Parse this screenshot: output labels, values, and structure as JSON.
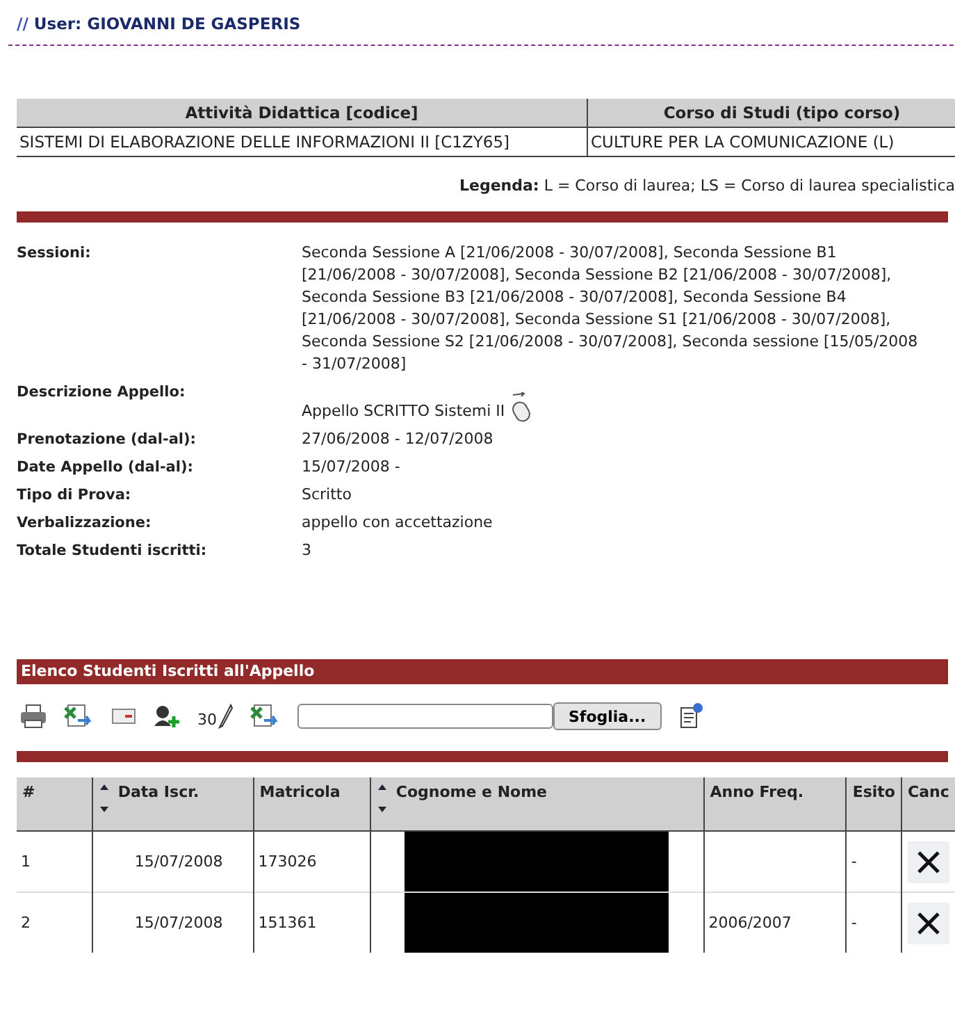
{
  "user_header": {
    "prefix": "//",
    "label": "User: GIOVANNI DE GASPERIS"
  },
  "course_table": {
    "columns": [
      "Attività Didattica [codice]",
      "Corso di Studi (tipo corso)"
    ],
    "rows": [
      [
        "SISTEMI DI ELABORAZIONE DELLE INFORMAZIONI II [C1ZY65]",
        "CULTURE PER LA COMUNICAZIONE (L)"
      ]
    ]
  },
  "legend": "**Legenda:** L = Corso di laurea; LS = Corso di laurea specialistica",
  "details": [
    {
      "label": "Sessioni:",
      "value": "Seconda Sessione A [21/06/2008 - 30/07/2008], Seconda Sessione B1 [21/06/2008 - 30/07/2008], Seconda Sessione B2 [21/06/2008 - 30/07/2008], Seconda Sessione B3 [21/06/2008 - 30/07/2008], Seconda Sessione B4 [21/06/2008 - 30/07/2008], Seconda Sessione S1 [21/06/2008 - 30/07/2008], Seconda Sessione S2 [21/06/2008 - 30/07/2008], Seconda sessione [15/05/2008 - 31/07/2008]",
      "kind": "text"
    },
    {
      "label": "Descrizione Appello:",
      "value": "Appello SCRITTO Sistemi II",
      "kind": "with_icon"
    },
    {
      "label": "Prenotazione (dal-al):",
      "value": "27/06/2008 - 12/07/2008",
      "kind": "text"
    },
    {
      "label": "Date Appello (dal-al):",
      "value": "15/07/2008 -",
      "kind": "text"
    },
    {
      "label": "Tipo di Prova:",
      "value": "Scritto",
      "kind": "text"
    },
    {
      "label": "Verbalizzazione:",
      "value": "appello con accettazione",
      "kind": "text"
    },
    {
      "label": "Totale Studenti iscritti:",
      "value": "3",
      "kind": "text"
    }
  ],
  "students_section": {
    "title": "Elenco Studenti Iscritti all'Appello",
    "toolbar": [
      {
        "kind": "print"
      },
      {
        "kind": "excel"
      },
      {
        "kind": "mail"
      },
      {
        "kind": "add_user"
      },
      {
        "kind": "grade",
        "label": "30"
      },
      {
        "kind": "excel"
      },
      {
        "kind": "file_field",
        "button": "Sfoglia..."
      },
      {
        "kind": "upload"
      }
    ],
    "columns": [
      {
        "label": "#",
        "sortable": false
      },
      {
        "label": "Data Iscr.",
        "sortable": true
      },
      {
        "label": "Matricola",
        "sortable": false
      },
      {
        "label": "Cognome e Nome",
        "sortable": true
      },
      {
        "label": "Anno Freq.",
        "sortable": false
      },
      {
        "label": "Esito",
        "sortable": false
      },
      {
        "label": "Canc",
        "sortable": false
      }
    ],
    "rows": [
      {
        "index": "1",
        "date": "15/07/2008",
        "matricola": "173026",
        "anno": "",
        "esito": "-"
      },
      {
        "index": "2",
        "date": "15/07/2008",
        "matricola": "151361",
        "anno": "2006/2007",
        "esito": "-"
      }
    ]
  }
}
